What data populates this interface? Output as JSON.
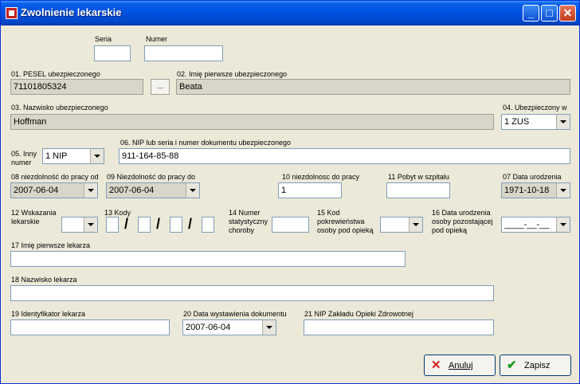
{
  "window": {
    "title": "Zwolnienie lekarskie",
    "min_icon": "minimize-icon",
    "max_icon": "maximize-icon",
    "close_icon": "close-icon"
  },
  "seria": {
    "label": "Seria",
    "value": ""
  },
  "numer": {
    "label": "Numer",
    "value": ""
  },
  "pesel": {
    "label": "01. PESEL ubezpieczonego",
    "value": "71101805324",
    "button": "..."
  },
  "imie": {
    "label": "02. Imię pierwsze ubezpieczonego",
    "value": "Beata"
  },
  "nazwisko": {
    "label": "03. Nazwisko ubezpieczonego",
    "value": "Hoffman"
  },
  "ubezpieczony": {
    "label": "04. Ubezpieczony w",
    "value": "1 ZUS"
  },
  "inny": {
    "label": "05. Inny numer",
    "value": "1 NIP"
  },
  "nip_dok": {
    "label": "06. NIP lub seria i numer dokumentu ubezpieczonego",
    "value": "911-164-85-88"
  },
  "od": {
    "label": "08 niezdolność do pracy od",
    "value": "2007-06-04"
  },
  "do": {
    "label": "09 Niezdolność do pracy do",
    "value": "2007-06-04"
  },
  "niezdolnosc": {
    "label": "10 niezdolnosc do pracy",
    "value": "1"
  },
  "pobyt": {
    "label": "11 Pobyt w szpitalu",
    "value": ""
  },
  "data_ur": {
    "label": "07 Data urodzenia",
    "value": "1971-10-18"
  },
  "wskazania": {
    "label": "12 Wskazania lekarskie",
    "value": ""
  },
  "kody": {
    "label": "13 Kody",
    "sep": "/"
  },
  "numer_stat": {
    "label": "14 Numer statystyczny choroby",
    "value": ""
  },
  "kod_pokr": {
    "label": "15 Kod pokrewieństwa osoby pod opieką",
    "value": ""
  },
  "data_ur_opieka": {
    "label": "16 Data urodzenia osoby pozostającej pod opieką",
    "value": "____-__-__"
  },
  "lek_imie": {
    "label": "17 Imię pierwsze lekarza",
    "value": ""
  },
  "lek_nazwisko": {
    "label": "18 Nazwisko lekarza",
    "value": ""
  },
  "lek_id": {
    "label": "19 Identyfikator lekarza",
    "value": ""
  },
  "data_wyst": {
    "label": "20 Data wystawienia dokumentu",
    "value": "2007-06-04"
  },
  "nip_zoz": {
    "label": "21 NIP Zakładu Opieki Zdrowotnej",
    "value": ""
  },
  "buttons": {
    "cancel": "Anuluj",
    "save": "Zapisz",
    "cancel_icon": "x-icon",
    "save_icon": "check-icon"
  },
  "colors": {
    "title_bar": "#0054e3",
    "dialog_bg": "#ece9d8",
    "readonly_bg": "#d9d6c9",
    "cancel_icon": "#d42020",
    "save_icon": "#1a9a1a"
  }
}
